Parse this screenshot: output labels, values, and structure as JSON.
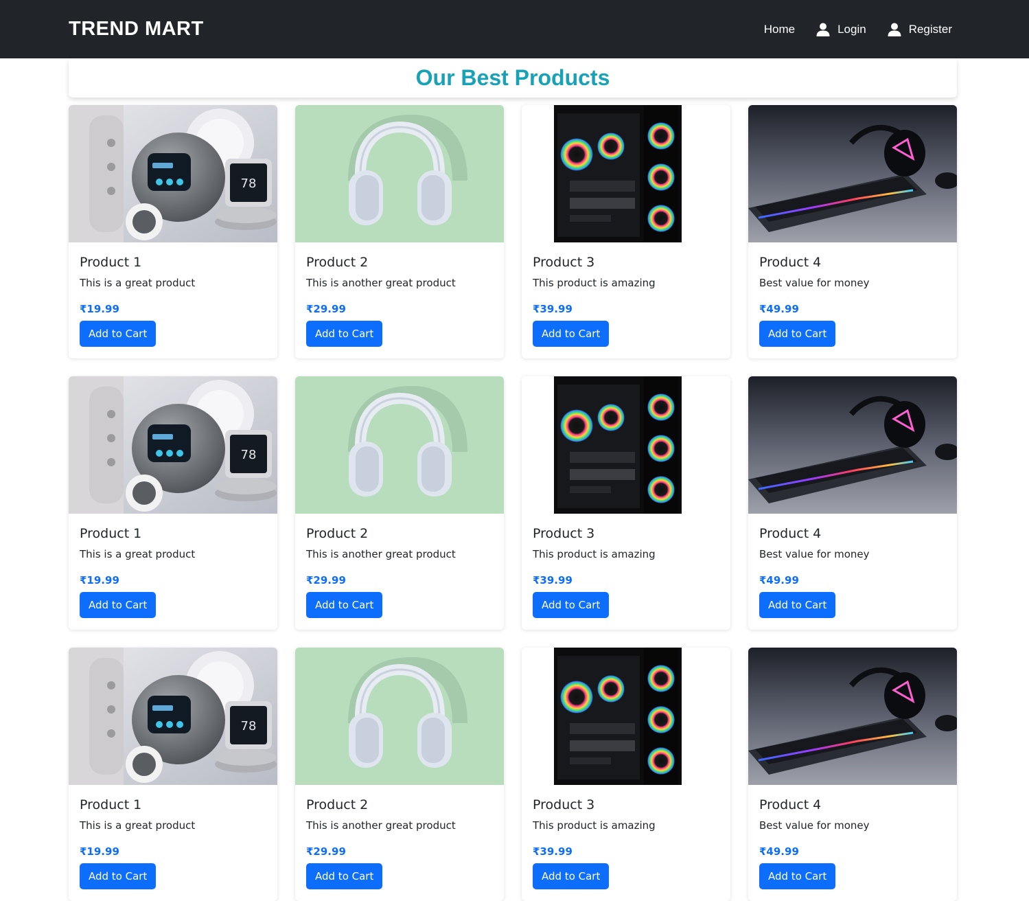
{
  "navbar": {
    "brand": "TREND MART",
    "links": [
      {
        "label": "Home",
        "icon": null
      },
      {
        "label": "Login",
        "icon": "user-icon"
      },
      {
        "label": "Register",
        "icon": "user-icon"
      }
    ]
  },
  "heading": "Our Best Products",
  "colors": {
    "navbar_bg": "#212529",
    "heading": "#17a2b8",
    "accent": "#0d6efd"
  },
  "products": [
    {
      "title": "Product 1",
      "description": "This is a great product",
      "price": "₹19.99",
      "button": "Add to Cart",
      "image": "smart-home-devices-image"
    },
    {
      "title": "Product 2",
      "description": "This is another great product",
      "price": "₹29.99",
      "button": "Add to Cart",
      "image": "headphones-image"
    },
    {
      "title": "Product 3",
      "description": "This product is amazing",
      "price": "₹39.99",
      "button": "Add to Cart",
      "image": "gaming-pc-image"
    },
    {
      "title": "Product 4",
      "description": "Best value for money",
      "price": "₹49.99",
      "button": "Add to Cart",
      "image": "keyboard-headset-image"
    },
    {
      "title": "Product 1",
      "description": "This is a great product",
      "price": "₹19.99",
      "button": "Add to Cart",
      "image": "smart-home-devices-image"
    },
    {
      "title": "Product 2",
      "description": "This is another great product",
      "price": "₹29.99",
      "button": "Add to Cart",
      "image": "headphones-image"
    },
    {
      "title": "Product 3",
      "description": "This product is amazing",
      "price": "₹39.99",
      "button": "Add to Cart",
      "image": "gaming-pc-image"
    },
    {
      "title": "Product 4",
      "description": "Best value for money",
      "price": "₹49.99",
      "button": "Add to Cart",
      "image": "keyboard-headset-image"
    },
    {
      "title": "Product 1",
      "description": "This is a great product",
      "price": "₹19.99",
      "button": "Add to Cart",
      "image": "smart-home-devices-image"
    },
    {
      "title": "Product 2",
      "description": "This is another great product",
      "price": "₹29.99",
      "button": "Add to Cart",
      "image": "headphones-image"
    },
    {
      "title": "Product 3",
      "description": "This product is amazing",
      "price": "₹39.99",
      "button": "Add to Cart",
      "image": "gaming-pc-image"
    },
    {
      "title": "Product 4",
      "description": "Best value for money",
      "price": "₹49.99",
      "button": "Add to Cart",
      "image": "keyboard-headset-image"
    }
  ]
}
